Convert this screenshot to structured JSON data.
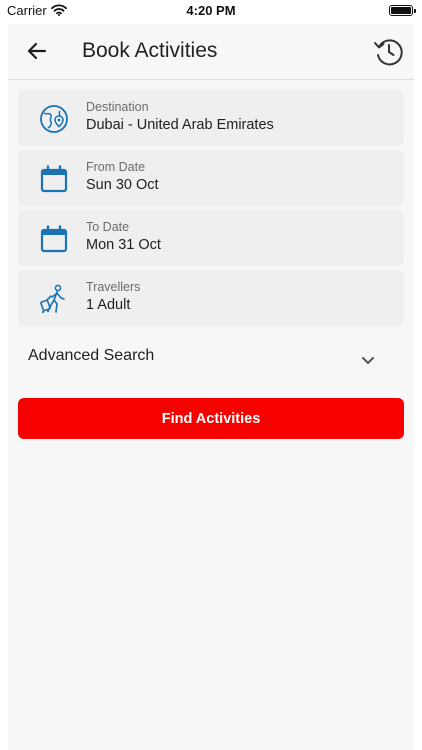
{
  "status_bar": {
    "carrier": "Carrier",
    "time": "4:20 PM"
  },
  "header": {
    "title": "Book Activities",
    "back_icon": "arrow-left-icon",
    "history_icon": "history-icon"
  },
  "fields": {
    "destination": {
      "label": "Destination",
      "value": "Dubai - United Arab Emirates",
      "icon": "globe-pin-icon"
    },
    "from_date": {
      "label": "From Date",
      "value": "Sun 30 Oct",
      "icon": "calendar-icon"
    },
    "to_date": {
      "label": "To Date",
      "value": "Mon 31 Oct",
      "icon": "calendar-icon"
    },
    "travellers": {
      "label": "Travellers",
      "value": "1 Adult",
      "icon": "traveller-luggage-icon"
    }
  },
  "advanced_search": {
    "label": "Advanced Search",
    "icon": "chevron-down-icon"
  },
  "find_button": {
    "label": "Find Activities"
  },
  "colors": {
    "accent_red": "#f70000",
    "icon_blue": "#1b73b3",
    "card_bg": "#efefef",
    "page_bg": "#f7f7f7"
  }
}
